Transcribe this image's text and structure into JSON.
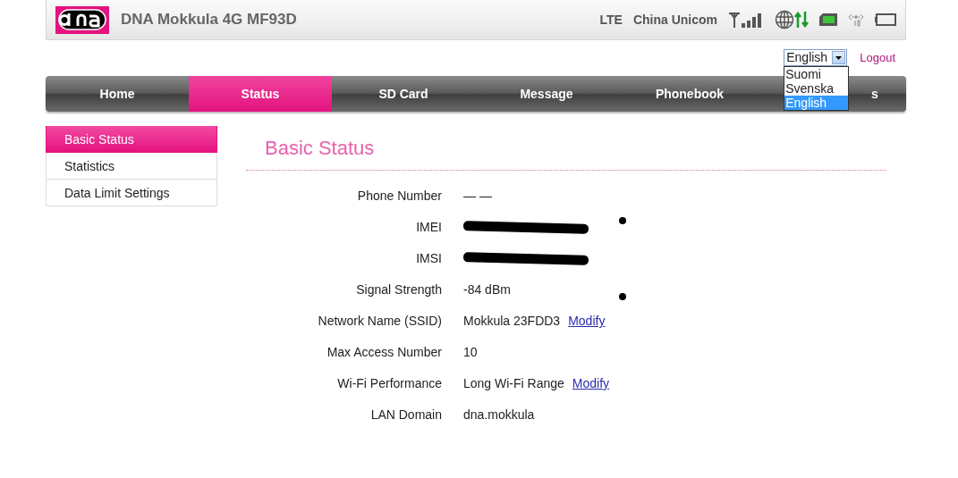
{
  "header": {
    "title": "DNA Mokkula 4G MF93D",
    "network_type": "LTE",
    "operator": "China Unicom"
  },
  "language": {
    "value": "English",
    "expanded": true,
    "options": [
      {
        "label": "Suomi",
        "selected": false
      },
      {
        "label": "Svenska",
        "selected": false
      },
      {
        "label": "English",
        "selected": true
      }
    ]
  },
  "logout": "Logout",
  "tabs": [
    {
      "label": "Home",
      "selected": false
    },
    {
      "label": "Status",
      "selected": true
    },
    {
      "label": "SD Card",
      "selected": false
    },
    {
      "label": "Message",
      "selected": false
    },
    {
      "label": "Phonebook",
      "selected": false
    },
    {
      "label": "s",
      "selected": false
    }
  ],
  "sidebar": {
    "items": [
      {
        "label": "Basic Status",
        "selected": true
      },
      {
        "label": "Statistics",
        "selected": false
      },
      {
        "label": "Data Limit Settings",
        "selected": false
      }
    ]
  },
  "page_title": "Basic Status",
  "fields": [
    {
      "label": "Phone Number",
      "value": "— —"
    },
    {
      "label": "IMEI",
      "redacted": true
    },
    {
      "label": "IMSI",
      "redacted": true
    },
    {
      "label": "Signal Strength",
      "value": "-84 dBm"
    },
    {
      "label": "Network Name (SSID)",
      "value": "Mokkula 23FDD3",
      "link": "Modify"
    },
    {
      "label": "Max Access Number",
      "value": "10"
    },
    {
      "label": "Wi-Fi Performance",
      "value": "Long Wi-Fi Range",
      "link": "Modify"
    },
    {
      "label": "LAN Domain",
      "value": "dna.mokkula"
    }
  ]
}
